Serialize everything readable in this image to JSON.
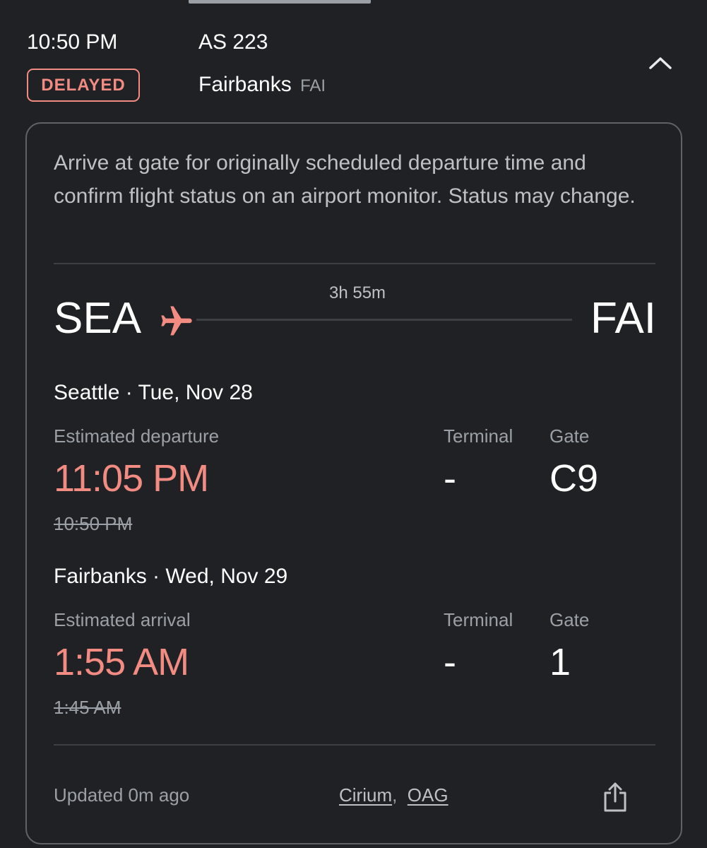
{
  "header": {
    "time": "10:50 PM",
    "flight": "AS 223",
    "status": "DELAYED",
    "destination_city": "Fairbanks",
    "destination_code": "FAI"
  },
  "card": {
    "notice": "Arrive at gate for originally scheduled departure time and confirm flight status on an airport monitor. Status may change.",
    "route": {
      "origin_code": "SEA",
      "destination_code": "FAI",
      "duration": "3h 55m"
    },
    "departure": {
      "city_date": "Seattle · Tue, Nov 28",
      "time_label": "Estimated departure",
      "time": "11:05 PM",
      "original_time": "10:50 PM",
      "terminal_label": "Terminal",
      "terminal": "-",
      "gate_label": "Gate",
      "gate": "C9"
    },
    "arrival": {
      "city_date": "Fairbanks · Wed, Nov 29",
      "time_label": "Estimated arrival",
      "time": "1:55 AM",
      "original_time": "1:45 AM",
      "terminal_label": "Terminal",
      "terminal": "-",
      "gate_label": "Gate",
      "gate": "1"
    },
    "footer": {
      "updated": "Updated 0m ago",
      "source_1": "Cirium",
      "separator": ",",
      "source_2": "OAG"
    }
  },
  "icons": {
    "collapse": "chevron-up-icon",
    "plane": "airplane-icon",
    "share": "share-icon"
  },
  "colors": {
    "background": "#202124",
    "accent_delayed": "#f28b82",
    "card_border": "#5f6368",
    "divider": "#3c4043"
  }
}
